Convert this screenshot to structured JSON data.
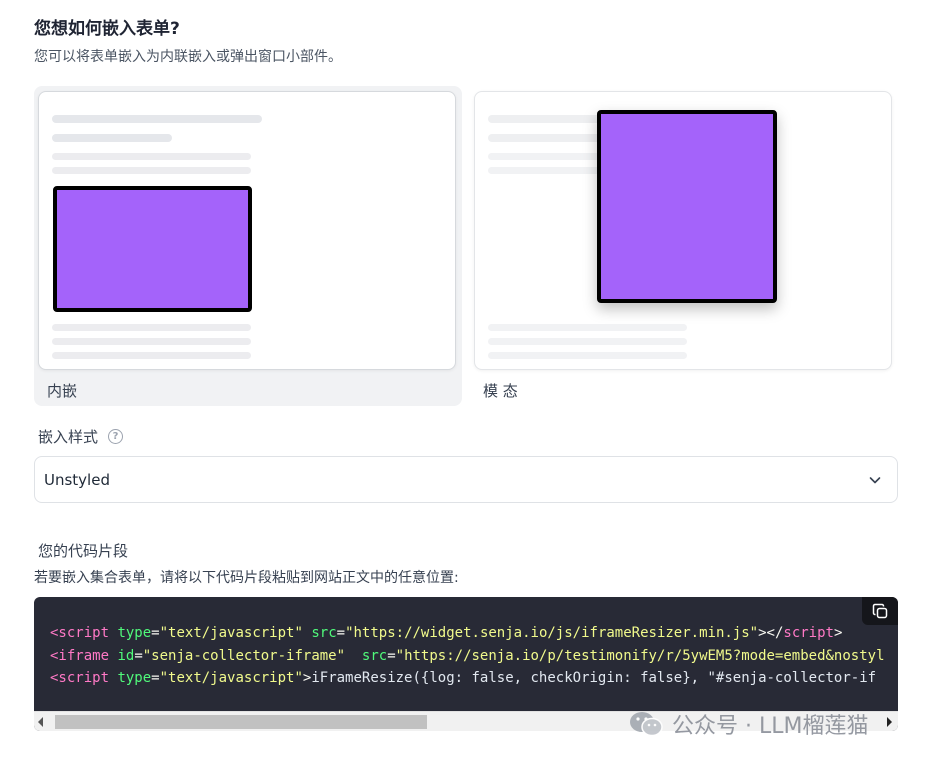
{
  "header": {
    "title": "您想如何嵌入表单?",
    "subtitle": "您可以将表单嵌入为内联嵌入或弹出窗口小部件。"
  },
  "embed_options": [
    {
      "label": "内嵌",
      "selected": true,
      "box_color": "#a463fa"
    },
    {
      "label": "模 态",
      "selected": false,
      "box_color": "#a463fa"
    }
  ],
  "embed_style": {
    "label": "嵌入样式",
    "help_icon": "question-circle-icon",
    "value": "Unstyled"
  },
  "snippet": {
    "label": "您的代码片段",
    "description": "若要嵌入集合表单，请将以下代码片段粘贴到网站正文中的任意位置:",
    "copy_icon": "copy-icon",
    "lines": [
      [
        {
          "t": "<script",
          "c": "tag"
        },
        {
          "t": " ",
          "c": "plain"
        },
        {
          "t": "type",
          "c": "attr"
        },
        {
          "t": "=",
          "c": "plain"
        },
        {
          "t": "\"text/javascript\"",
          "c": "str"
        },
        {
          "t": " ",
          "c": "plain"
        },
        {
          "t": "src",
          "c": "attr"
        },
        {
          "t": "=",
          "c": "plain"
        },
        {
          "t": "\"https://widget.senja.io/js/iframeResizer.min.js\"",
          "c": "str"
        },
        {
          "t": "></",
          "c": "plain"
        },
        {
          "t": "script",
          "c": "tag"
        },
        {
          "t": ">",
          "c": "plain"
        }
      ],
      [
        {
          "t": "<iframe",
          "c": "tag"
        },
        {
          "t": " ",
          "c": "plain"
        },
        {
          "t": "id",
          "c": "attr"
        },
        {
          "t": "=",
          "c": "plain"
        },
        {
          "t": "\"senja-collector-iframe\"",
          "c": "str"
        },
        {
          "t": "  ",
          "c": "plain"
        },
        {
          "t": "src",
          "c": "attr"
        },
        {
          "t": "=",
          "c": "plain"
        },
        {
          "t": "\"https://senja.io/p/testimonify/r/5ywEM5?mode=embed&nostyl",
          "c": "str"
        }
      ],
      [
        {
          "t": "<script",
          "c": "tag"
        },
        {
          "t": " ",
          "c": "plain"
        },
        {
          "t": "type",
          "c": "attr"
        },
        {
          "t": "=",
          "c": "plain"
        },
        {
          "t": "\"text/javascript\"",
          "c": "str"
        },
        {
          "t": ">",
          "c": "plain"
        },
        {
          "t": "iFrameResize({log: false, checkOrigin: false}, \"#senja-collector-if",
          "c": "js"
        }
      ]
    ]
  },
  "watermark": {
    "icon": "wechat-icon",
    "text": "公众号 · LLM榴莲猫"
  }
}
